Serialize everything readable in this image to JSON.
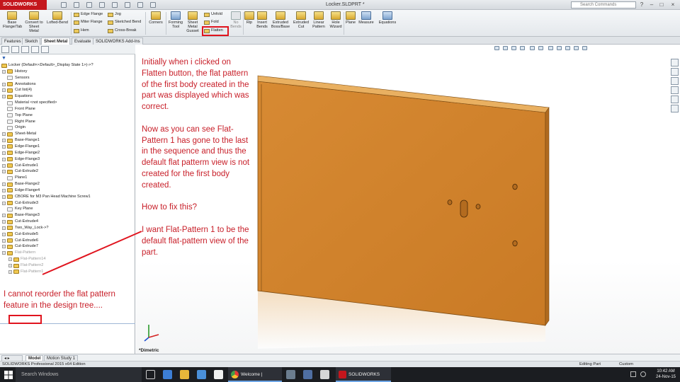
{
  "app": {
    "logo": "SOLIDWORKS",
    "window_title": "Locker.SLDPRT *",
    "search_placeholder": "Search Commands",
    "window_controls": [
      "?",
      "–",
      "□",
      "×"
    ]
  },
  "ribbon": {
    "large_buttons": [
      {
        "id": "base-flange",
        "label": "Base Flange/Tab"
      },
      {
        "id": "convert",
        "label": "Convert to Sheet Metal"
      },
      {
        "id": "lofted",
        "label": "Lofted-Bend"
      },
      {
        "id": "corners",
        "label": "Corners"
      },
      {
        "id": "forming",
        "label": "Forming Tool"
      },
      {
        "id": "gusset",
        "label": "Sheet Metal Gusset"
      },
      {
        "id": "nobends",
        "label": "No Bends"
      },
      {
        "id": "rip",
        "label": "Rip"
      },
      {
        "id": "insert-bends",
        "label": "Insert Bends"
      },
      {
        "id": "extruded-boss",
        "label": "Extruded Boss/Base"
      },
      {
        "id": "extruded-cut",
        "label": "Extruded Cut"
      },
      {
        "id": "linear-pattern",
        "label": "Linear Pattern"
      },
      {
        "id": "hole-wizard",
        "label": "Hole Wizard"
      },
      {
        "id": "plane",
        "label": "Plane"
      },
      {
        "id": "measure",
        "label": "Measure"
      },
      {
        "id": "equations",
        "label": "Equations"
      }
    ],
    "small_buttons": [
      {
        "id": "edge-flange",
        "label": "Edge Flange"
      },
      {
        "id": "miter-flange",
        "label": "Miter Flange"
      },
      {
        "id": "hem",
        "label": "Hem"
      },
      {
        "id": "jog",
        "label": "Jog"
      },
      {
        "id": "sketched-bend",
        "label": "Sketched Bend"
      },
      {
        "id": "cross-break",
        "label": "Cross-Break"
      },
      {
        "id": "unfold",
        "label": "Unfold"
      },
      {
        "id": "fold",
        "label": "Fold"
      },
      {
        "id": "flatten",
        "label": "Flatten"
      }
    ]
  },
  "tabs": [
    "Features",
    "Sketch",
    "Sheet Metal",
    "Evaluate",
    "SOLIDWORKS Add-Ins"
  ],
  "active_tab": "Sheet Metal",
  "tree": {
    "root": "Locker  (Default<<Default>_Display State 1>)->?",
    "items": [
      "History",
      "Sensors",
      "Annotations",
      "Cut list(4)",
      "Equations",
      "Material <not specified>",
      "Front Plane",
      "Top Plane",
      "Right Plane",
      "Origin",
      "Sheet-Metal",
      "Base-Flange1",
      "Edge-Flange1",
      "Edge-Flange2",
      "Edge-Flange3",
      "Cut-Extrude1",
      "Cut-Extrude2",
      "Plane1",
      "Base-Flange2",
      "Edge-Flange4",
      "CBORE for M3 Pan Head Machine Screw1",
      "Cut-Extrude3",
      "Key Plane",
      "Base-Flange3",
      "Cut-Extrude4",
      "Two_Way_Lock->?",
      "Cut-Extrude5",
      "Cut-Extrude6",
      "Cut-Extrude7",
      "Flat-Pattern"
    ],
    "flat_children": [
      "Flat-Pattern14",
      "Flat-Pattern2",
      "Flat-Pattern1"
    ]
  },
  "notes": {
    "left": "I cannot reorder the flat pattern feature in the design tree....",
    "main_1": "Initially when i clicked on Flatten button, the flat pattern of the first body created in the part was displayed which was correct.",
    "main_2": "Now as you can see Flat-Pattern 1 has gone to the last in the sequence and thus the default flat patterm view is not created for the first body created.",
    "main_3": "How to fix this?",
    "main_4": "I want Flat-Pattern 1 to be the default flat-pattern view of the part."
  },
  "view": {
    "label": "*Dimetric"
  },
  "bottom_tabs": [
    "Model",
    "Motion Study 1"
  ],
  "status": {
    "left": "SOLIDWORKS Professional 2015 x64 Edition",
    "mode": "Editing Part",
    "units": "Custom"
  },
  "taskbar": {
    "search": "Search Windows",
    "apps": [
      "Welcome | SOLIDW...",
      "SOLIDWORKS Profe..."
    ],
    "time": "10:42 AM",
    "date": "24-Nov-15"
  },
  "colors": {
    "accent_red": "#e0141e",
    "note_red": "#c8202a",
    "model_orange": "#d98b32"
  }
}
